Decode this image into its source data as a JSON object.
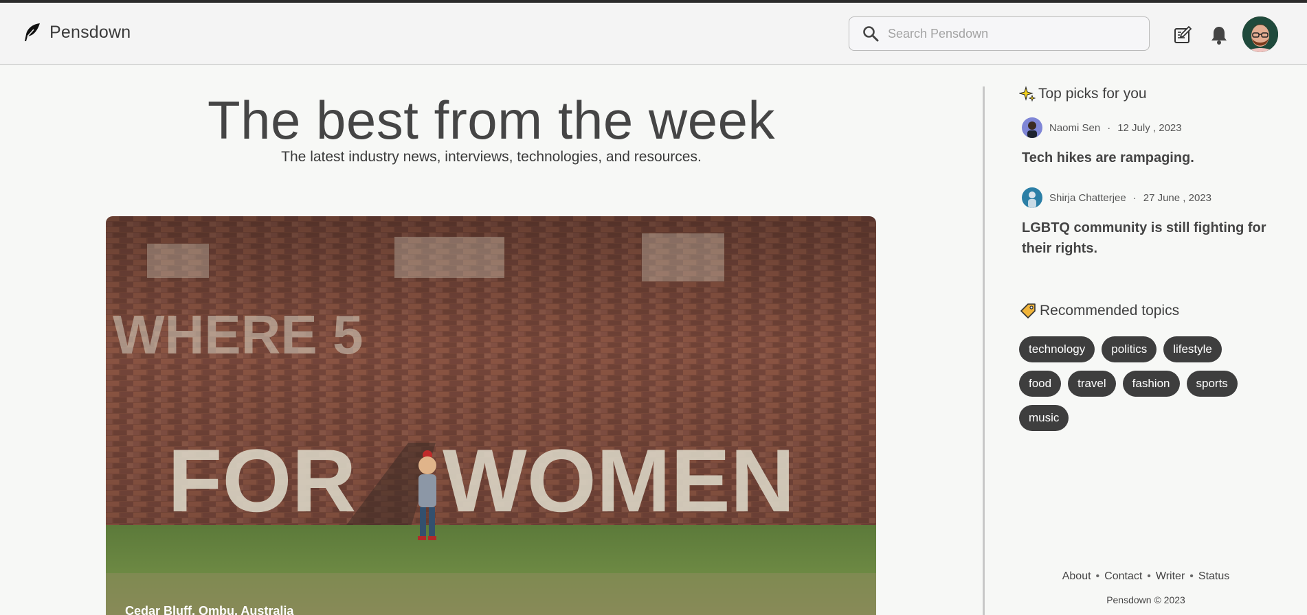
{
  "header": {
    "brand": "Pensdown",
    "search_placeholder": "Search Pensdown",
    "icons": [
      "feather-logo-icon",
      "search-icon",
      "write-icon",
      "bell-icon",
      "avatar"
    ]
  },
  "hero": {
    "title": "The best from the week",
    "subtitle": "The latest industry news, interviews, technologies, and resources.",
    "image_caption": "Cedar Bluff, Ombu, Australia"
  },
  "sidebar": {
    "top_picks_title": "Top picks for you",
    "picks": [
      {
        "author": "Naomi Sen",
        "date": "12 July , 2023",
        "title": "Tech hikes are rampaging."
      },
      {
        "author": "Shirja Chatterjee",
        "date": "27 June , 2023",
        "title": "LGBTQ community is still fighting for their rights."
      }
    ],
    "topics_title": "Recommended topics",
    "topics": [
      "technology",
      "politics",
      "lifestyle",
      "food",
      "travel",
      "fashion",
      "sports",
      "music"
    ],
    "footer_links": [
      "About",
      "Contact",
      "Writer",
      "Status"
    ],
    "copyright": "Pensdown © 2023"
  },
  "colors": {
    "background": "#f7f8f6",
    "header_bg": "#f4f4f4",
    "tag_bg": "#3e3e3e",
    "text": "#3f3f3f"
  }
}
